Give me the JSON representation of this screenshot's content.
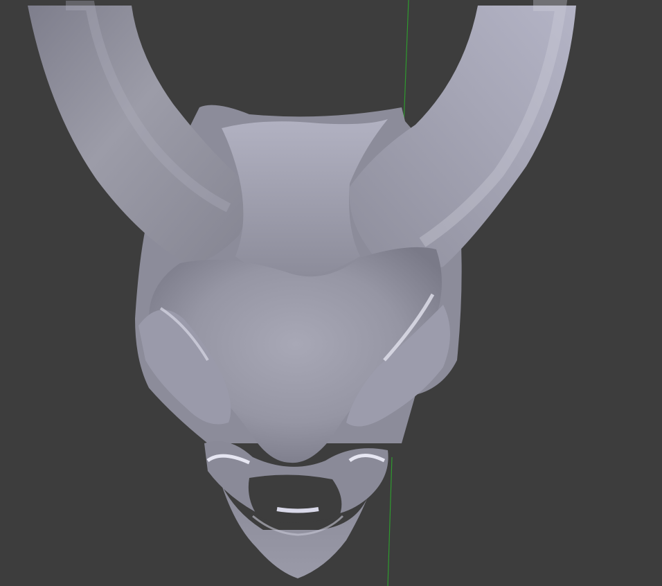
{
  "viewport": {
    "background": "#3d3d3d",
    "object": "horned-skull-mask-mesh",
    "shading": "solid",
    "axis_color": "#2e9a2e"
  }
}
